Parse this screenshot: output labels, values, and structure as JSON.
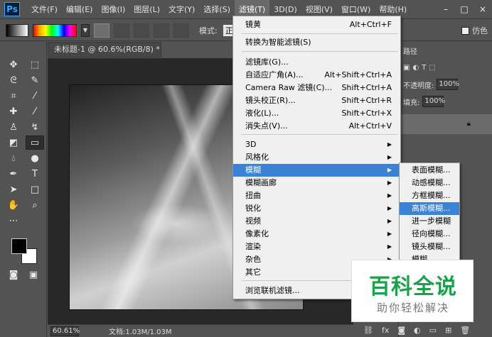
{
  "menubar": {
    "logo": "Ps",
    "items": [
      "文件(F)",
      "编辑(E)",
      "图像(I)",
      "图层(L)",
      "文字(Y)",
      "选择(S)",
      "滤镜(T)",
      "3D(D)",
      "视图(V)",
      "窗口(W)",
      "帮助(H)"
    ],
    "active_index": 6,
    "window_controls": [
      "–",
      "□",
      "×"
    ]
  },
  "options_bar": {
    "mode_label": "模式:",
    "mode_value": "正",
    "fake_label": "仿色"
  },
  "document": {
    "tab_title": "未标题-1 @ 60.6%(RGB/8) *",
    "tab_close": "×",
    "zoom": "60.61%",
    "doc_info": "文档:1.03M/1.03M"
  },
  "right_panel": {
    "tab_label": "路径",
    "opacity_label": "不透明度:",
    "opacity_value": "100%",
    "fill_label": "填充:",
    "fill_value": "100%"
  },
  "filter_menu": {
    "items": [
      {
        "label": "镜黄",
        "shortcut": "Alt+Ctrl+F"
      },
      {
        "label": "转换为智能滤镜(S)",
        "shortcut": ""
      },
      {
        "label": "滤镜库(G)...",
        "shortcut": ""
      },
      {
        "label": "自适应广角(A)...",
        "shortcut": "Alt+Shift+Ctrl+A"
      },
      {
        "label": "Camera Raw 滤镜(C)...",
        "shortcut": "Shift+Ctrl+A"
      },
      {
        "label": "镜头校正(R)...",
        "shortcut": "Shift+Ctrl+R"
      },
      {
        "label": "液化(L)...",
        "shortcut": "Shift+Ctrl+X"
      },
      {
        "label": "消失点(V)...",
        "shortcut": "Alt+Ctrl+V"
      },
      {
        "label": "3D",
        "submenu": true
      },
      {
        "label": "风格化",
        "submenu": true
      },
      {
        "label": "模糊",
        "submenu": true,
        "highlighted": true
      },
      {
        "label": "模糊画廊",
        "submenu": true
      },
      {
        "label": "扭曲",
        "submenu": true
      },
      {
        "label": "锐化",
        "submenu": true
      },
      {
        "label": "视频",
        "submenu": true
      },
      {
        "label": "像素化",
        "submenu": true
      },
      {
        "label": "渲染",
        "submenu": true
      },
      {
        "label": "杂色",
        "submenu": true
      },
      {
        "label": "其它",
        "submenu": true
      },
      {
        "label": "浏览联机滤镜...",
        "shortcut": ""
      }
    ],
    "arrow": "▶"
  },
  "blur_submenu": {
    "items": [
      "表面模糊...",
      "动感模糊...",
      "方框模糊...",
      "高斯模糊...",
      "进一步模糊",
      "径向模糊...",
      "镜头模糊...",
      "模糊"
    ],
    "highlighted_index": 3
  },
  "watermark": {
    "title": "百科全说",
    "subtitle": "助你轻松解决"
  },
  "colors": {
    "menu_highlight": "#3b83d6",
    "watermark_green": "#1aa24b",
    "ui_bg": "#535353"
  }
}
